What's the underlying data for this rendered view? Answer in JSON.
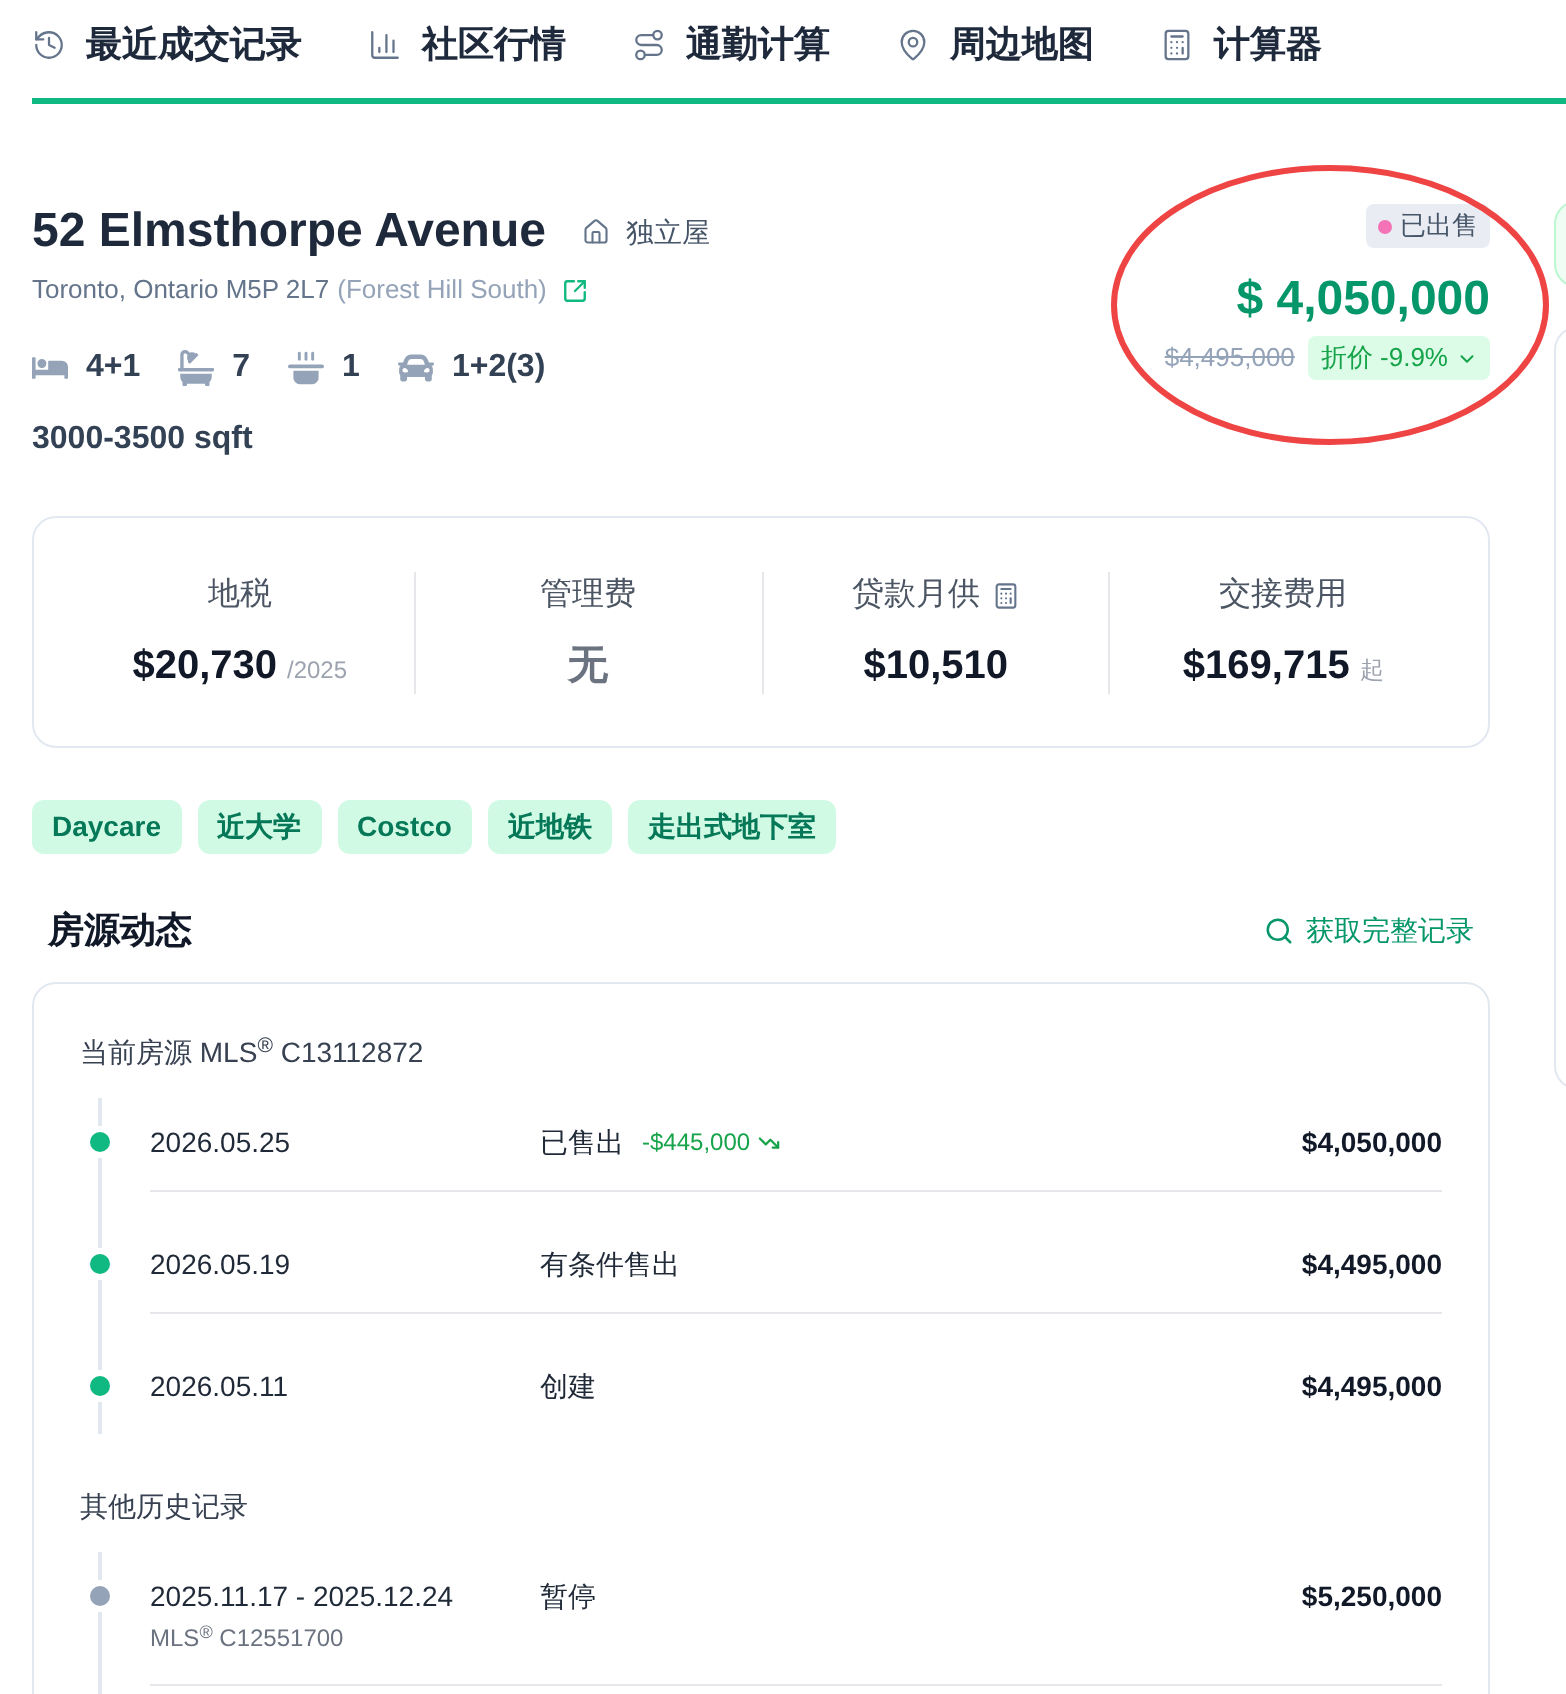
{
  "nav": {
    "tabs": [
      {
        "label": "最近成交记录"
      },
      {
        "label": "社区行情"
      },
      {
        "label": "通勤计算"
      },
      {
        "label": "周边地图"
      },
      {
        "label": "计算器"
      }
    ]
  },
  "listing": {
    "address": "52 Elmsthorpe Avenue",
    "property_type": "独立屋",
    "location": "Toronto, Ontario M5P 2L7",
    "neighbourhood": "(Forest Hill South)",
    "features": [
      {
        "kind": "bedrooms",
        "value": "4+1"
      },
      {
        "kind": "bathrooms",
        "value": "7"
      },
      {
        "kind": "kitchens",
        "value": "1"
      },
      {
        "kind": "parking",
        "value": "1+2(3)"
      }
    ],
    "size": "3000-3500 sqft",
    "status": "已出售",
    "price": "$ 4,050,000",
    "original_price": "$4,495,000",
    "discount": "折价 -9.9%"
  },
  "stats": [
    {
      "kind": "amount",
      "label": "地税",
      "value": "$20,730",
      "suffix": "/2025"
    },
    {
      "kind": "none",
      "label": "管理费",
      "value": "无"
    },
    {
      "kind": "amount",
      "label": "贷款月供",
      "value": "$10,510",
      "calculator": true
    },
    {
      "kind": "amount",
      "label": "交接费用",
      "value": "$169,715",
      "suffix": "起"
    }
  ],
  "tags": [
    "Daycare",
    "近大学",
    "Costco",
    "近地铁",
    "走出式地下室"
  ],
  "history": {
    "title": "房源动态",
    "link": "获取完整记录",
    "groups": [
      {
        "title": "当前房源 MLS$^{®}$ C13112872",
        "current": true,
        "events": [
          {
            "date": "2026.05.25",
            "event": "已售出",
            "change": "-$445,000",
            "price": "$4,050,000"
          },
          {
            "date": "2026.05.19",
            "event": "有条件售出",
            "price": "$4,495,000"
          },
          {
            "date": "2026.05.11",
            "event": "创建",
            "price": "$4,495,000"
          }
        ]
      },
      {
        "title": "其他历史记录",
        "current": false,
        "events": [
          {
            "date": "2025.11.17 - 2025.12.24",
            "mls": "MLS$^{®}$ C12551700",
            "event": "暂停",
            "price": "$5,250,000"
          }
        ]
      }
    ]
  }
}
